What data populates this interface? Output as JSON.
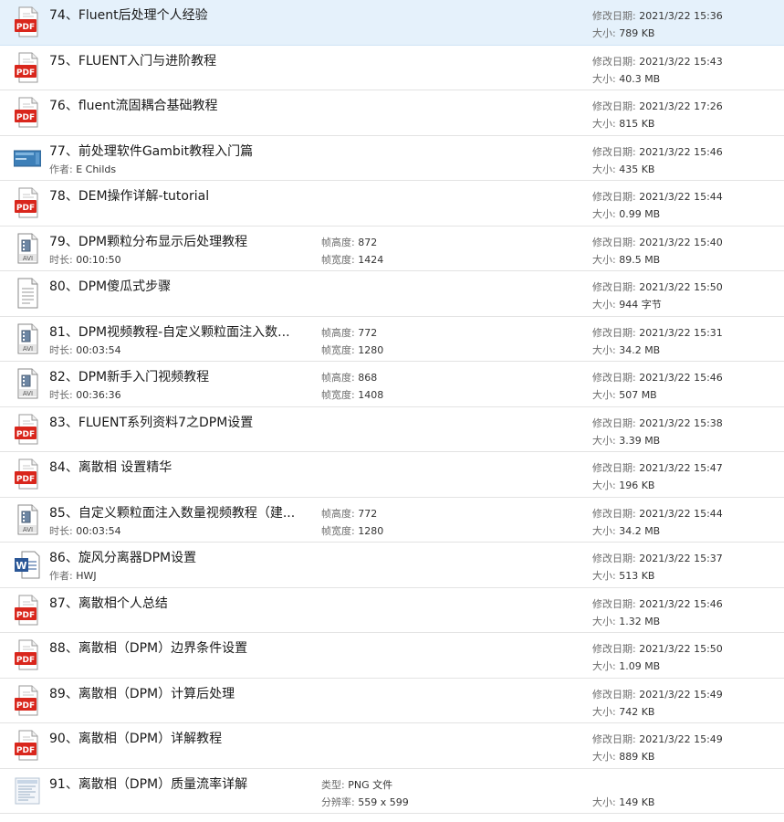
{
  "labels": {
    "modified": "修改日期: ",
    "size": "大小: ",
    "author": "作者: ",
    "duration": "时长: ",
    "frame_height": "帧高度: ",
    "frame_width": "帧宽度: ",
    "type": "类型: ",
    "resolution": "分辨率: "
  },
  "files": [
    {
      "icon": "pdf",
      "name": "74、Fluent后处理个人经验",
      "date": "2021/3/22 15:36",
      "size": "789 KB",
      "selected": true
    },
    {
      "icon": "pdf",
      "name": "75、FLUENT入门与进阶教程",
      "date": "2021/3/22 15:43",
      "size": "40.3 MB"
    },
    {
      "icon": "pdf",
      "name": "76、fluent流固耦合基础教程",
      "date": "2021/3/22 17:26",
      "size": "815 KB"
    },
    {
      "icon": "book",
      "name": "77、前处理软件Gambit教程入门篇",
      "author": "E Childs",
      "date": "2021/3/22 15:46",
      "size": "435 KB"
    },
    {
      "icon": "pdf",
      "name": "78、DEM操作详解-tutorial",
      "date": "2021/3/22 15:44",
      "size": "0.99 MB"
    },
    {
      "icon": "avi",
      "name": "79、DPM颗粒分布显示后处理教程",
      "duration": "00:10:50",
      "frame_height": "872",
      "frame_width": "1424",
      "date": "2021/3/22 15:40",
      "size": "89.5 MB"
    },
    {
      "icon": "txt",
      "name": "80、DPM傻瓜式步骤",
      "date": "2021/3/22 15:50",
      "size": "944 字节"
    },
    {
      "icon": "avi",
      "name": "81、DPM视频教程-自定义颗粒面注入数...",
      "duration": "00:03:54",
      "frame_height": "772",
      "frame_width": "1280",
      "date": "2021/3/22 15:31",
      "size": "34.2 MB"
    },
    {
      "icon": "avi",
      "name": "82、DPM新手入门视频教程",
      "duration": "00:36:36",
      "frame_height": "868",
      "frame_width": "1408",
      "date": "2021/3/22 15:46",
      "size": "507 MB"
    },
    {
      "icon": "pdf",
      "name": "83、FLUENT系列资料7之DPM设置",
      "date": "2021/3/22 15:38",
      "size": "3.39 MB"
    },
    {
      "icon": "pdf",
      "name": "84、离散相 设置精华",
      "date": "2021/3/22 15:47",
      "size": "196 KB"
    },
    {
      "icon": "avi",
      "name": "85、自定义颗粒面注入数量视频教程（建...",
      "duration": "00:03:54",
      "frame_height": "772",
      "frame_width": "1280",
      "date": "2021/3/22 15:44",
      "size": "34.2 MB"
    },
    {
      "icon": "word",
      "name": "86、旋风分离器DPM设置",
      "author": "HWJ",
      "date": "2021/3/22 15:37",
      "size": "513 KB"
    },
    {
      "icon": "pdf",
      "name": "87、离散相个人总结",
      "date": "2021/3/22 15:46",
      "size": "1.32 MB"
    },
    {
      "icon": "pdf",
      "name": "88、离散相（DPM）边界条件设置",
      "date": "2021/3/22 15:50",
      "size": "1.09 MB"
    },
    {
      "icon": "pdf",
      "name": "89、离散相（DPM）计算后处理",
      "date": "2021/3/22 15:49",
      "size": "742 KB"
    },
    {
      "icon": "pdf",
      "name": "90、离散相（DPM）详解教程",
      "date": "2021/3/22 15:49",
      "size": "889 KB"
    },
    {
      "icon": "png",
      "name": "91、离散相（DPM）质量流率详解",
      "type": "PNG 文件",
      "resolution": "559 x 599",
      "size": "149 KB"
    }
  ]
}
